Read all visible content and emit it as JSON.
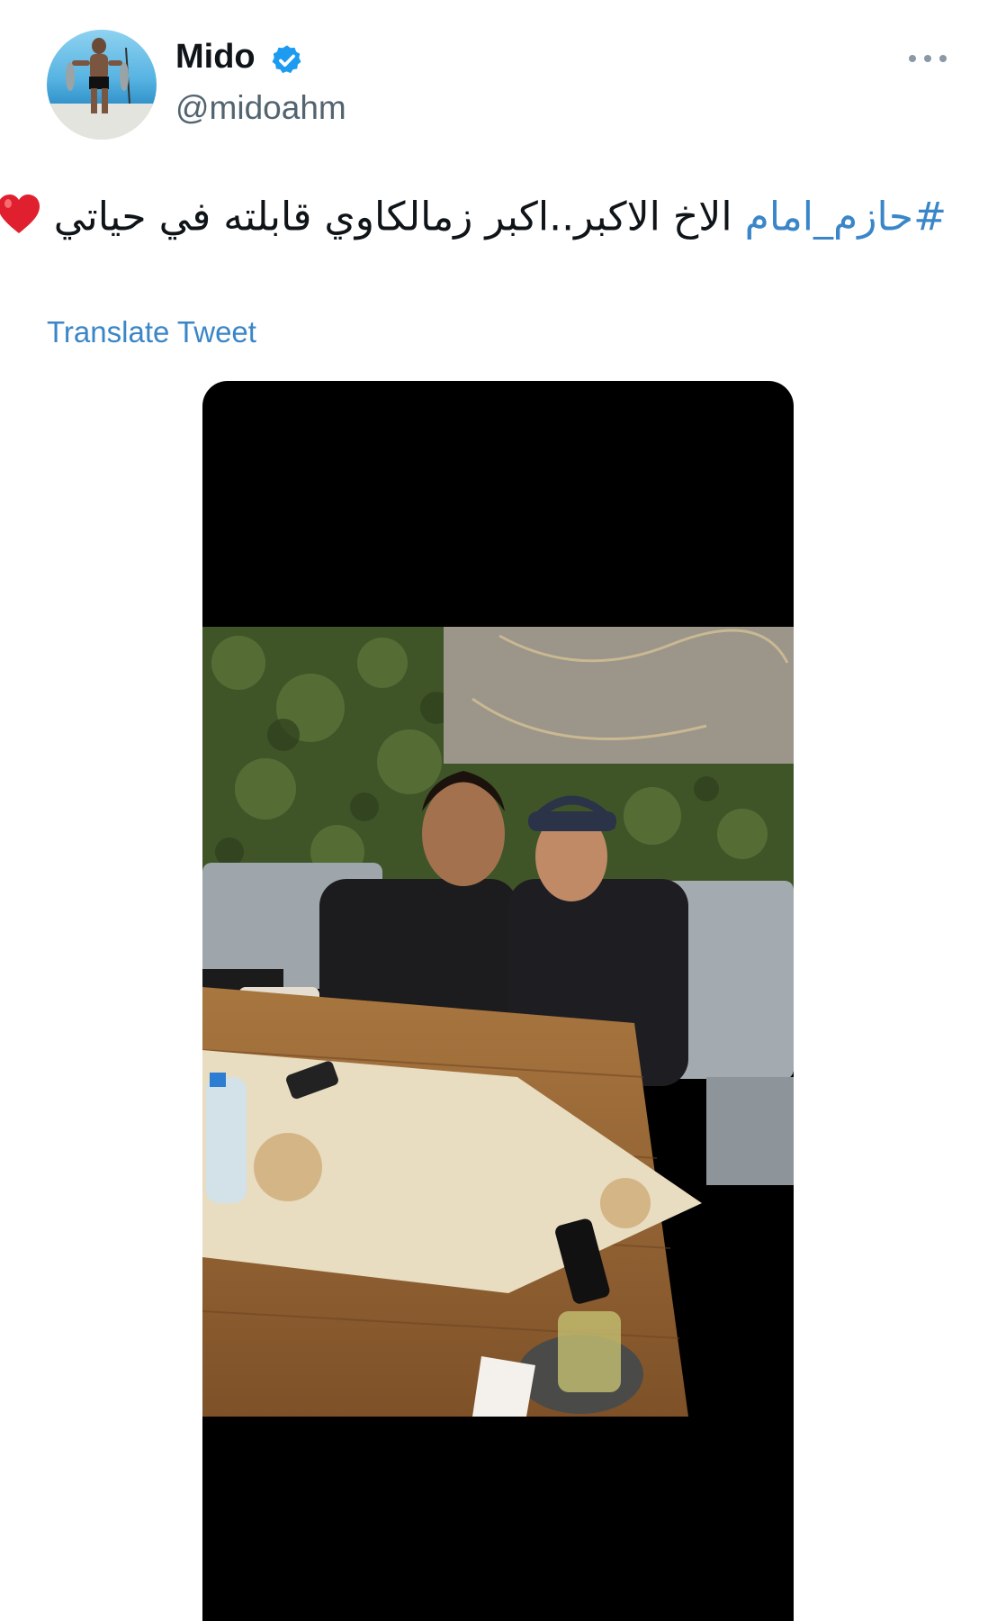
{
  "author": {
    "name": "Mido",
    "handle": "@midoahm",
    "verified": true,
    "avatar_icon": "profile-photo"
  },
  "tweet": {
    "hashtag": "#حازم_امام",
    "text": " الاخ الاكبر..اكبر زمالكاوي قابلته في حياتي",
    "emoji_icon": "red-heart-icon"
  },
  "translate_label": "Translate Tweet",
  "colors": {
    "link": "#3a86c8",
    "verified_badge": "#1d9bf0",
    "secondary_text": "#536471"
  },
  "media": {
    "description_icon": "photo-two-men-at-cafe-table"
  }
}
